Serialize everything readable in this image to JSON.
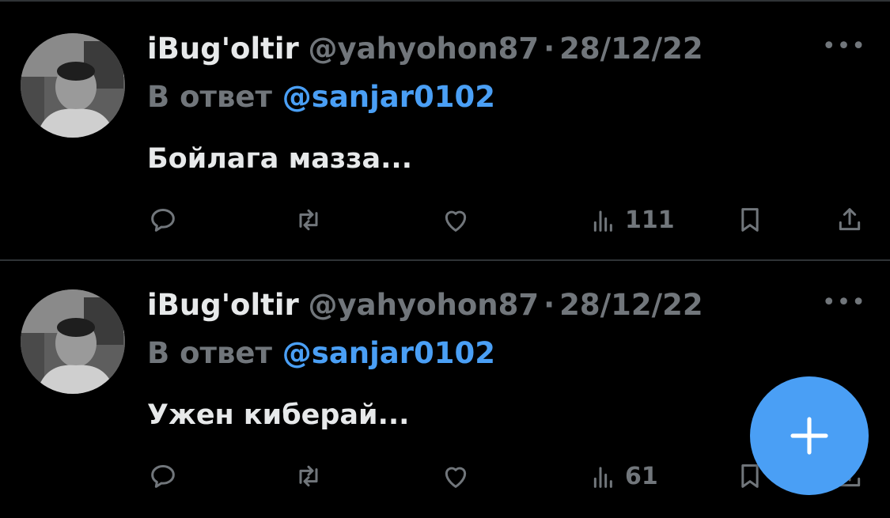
{
  "colors": {
    "background": "#000000",
    "text": "#e7e9ea",
    "muted": "#71767b",
    "accent": "#4a9ff5",
    "divider": "#2f3336"
  },
  "tweets": [
    {
      "display_name": "iBug'oltir",
      "handle": "@yahyohon87",
      "separator": "·",
      "date": "28/12/22",
      "reply_prefix": "В ответ",
      "reply_target": "@sanjar0102",
      "text": "Бойлага мазза...",
      "more_label": "•••",
      "views": "111",
      "icons": [
        "reply-icon",
        "retweet-icon",
        "like-icon",
        "views-icon",
        "bookmark-icon",
        "share-icon"
      ]
    },
    {
      "display_name": "iBug'oltir",
      "handle": "@yahyohon87",
      "separator": "·",
      "date": "28/12/22",
      "reply_prefix": "В ответ",
      "reply_target": "@sanjar0102",
      "text": "Ужен киберай...",
      "more_label": "•••",
      "views": "61",
      "icons": [
        "reply-icon",
        "retweet-icon",
        "like-icon",
        "views-icon",
        "bookmark-icon",
        "share-icon"
      ]
    }
  ],
  "compose_button": {
    "icon": "plus-icon"
  }
}
